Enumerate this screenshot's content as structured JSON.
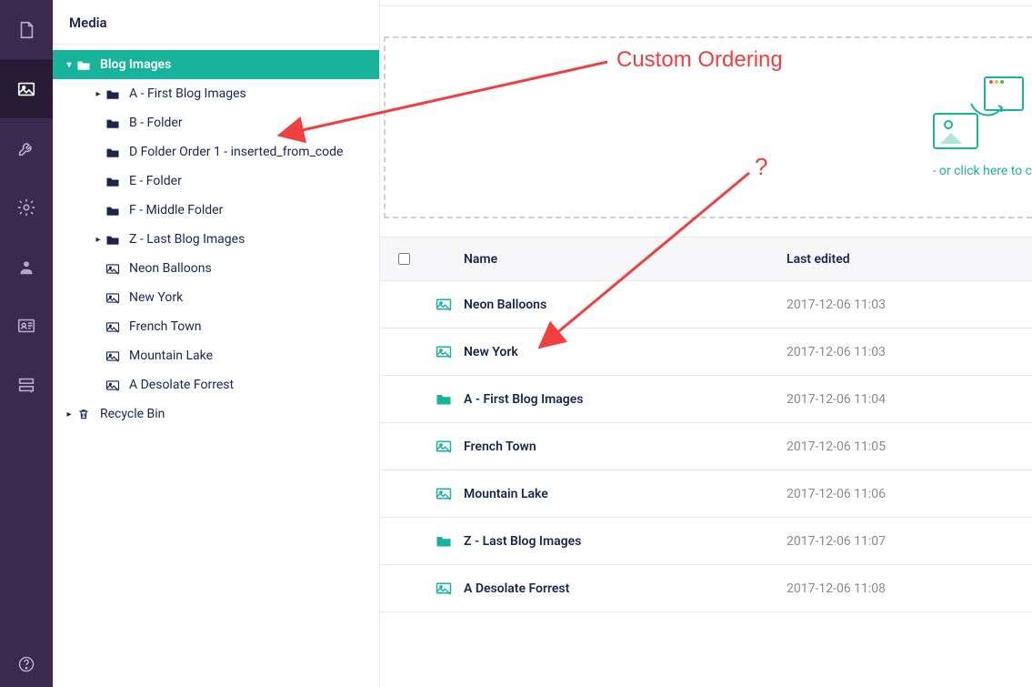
{
  "section_title": "Media",
  "tree": {
    "root": {
      "label": "Blog Images"
    },
    "children": [
      {
        "label": "A - First Blog Images",
        "type": "folder",
        "has_children": true
      },
      {
        "label": "B - Folder",
        "type": "folder",
        "has_children": false
      },
      {
        "label": "D Folder Order 1 - inserted_from_code",
        "type": "folder",
        "has_children": false
      },
      {
        "label": "E - Folder",
        "type": "folder",
        "has_children": false
      },
      {
        "label": "F - Middle Folder",
        "type": "folder",
        "has_children": false
      },
      {
        "label": "Z - Last Blog Images",
        "type": "folder",
        "has_children": true
      },
      {
        "label": "Neon Balloons",
        "type": "image",
        "has_children": false
      },
      {
        "label": "New York",
        "type": "image",
        "has_children": false
      },
      {
        "label": "French Town",
        "type": "image",
        "has_children": false
      },
      {
        "label": "Mountain Lake",
        "type": "image",
        "has_children": false
      },
      {
        "label": "A Desolate Forrest",
        "type": "image",
        "has_children": false
      }
    ],
    "recycle_bin": "Recycle Bin"
  },
  "dropzone": {
    "text": "- or click here to c"
  },
  "table": {
    "headers": {
      "name": "Name",
      "last_edited": "Last edited"
    },
    "rows": [
      {
        "name": "Neon Balloons",
        "type": "image",
        "last_edited": "2017-12-06 11:03"
      },
      {
        "name": "New York",
        "type": "image",
        "last_edited": "2017-12-06 11:03"
      },
      {
        "name": "A - First Blog Images",
        "type": "folder",
        "last_edited": "2017-12-06 11:04"
      },
      {
        "name": "French Town",
        "type": "image",
        "last_edited": "2017-12-06 11:05"
      },
      {
        "name": "Mountain Lake",
        "type": "image",
        "last_edited": "2017-12-06 11:06"
      },
      {
        "name": "Z - Last Blog Images",
        "type": "folder",
        "last_edited": "2017-12-06 11:07"
      },
      {
        "name": "A Desolate Forrest",
        "type": "image",
        "last_edited": "2017-12-06 11:08"
      }
    ]
  },
  "annotations": {
    "custom_ordering": "Custom Ordering",
    "question": "?"
  }
}
